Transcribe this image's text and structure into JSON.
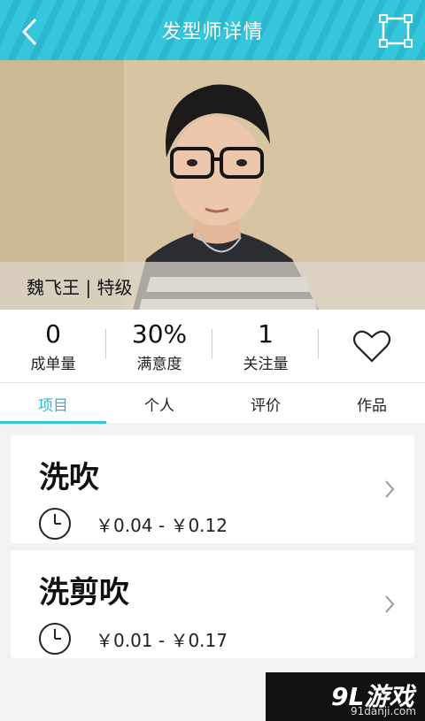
{
  "header": {
    "title": "发型师详情"
  },
  "profile": {
    "name_line": "魏飞王 | 特级"
  },
  "stats": [
    {
      "value": "0",
      "label": "成单量"
    },
    {
      "value": "30%",
      "label": "满意度"
    },
    {
      "value": "1",
      "label": "关注量"
    }
  ],
  "tabs": [
    {
      "label": "项目",
      "active": true
    },
    {
      "label": "个人",
      "active": false
    },
    {
      "label": "评价",
      "active": false
    },
    {
      "label": "作品",
      "active": false
    }
  ],
  "services": [
    {
      "name": "洗吹",
      "price": "￥0.04 - ￥0.12"
    },
    {
      "name": "洗剪吹",
      "price": "￥0.01 - ￥0.17"
    }
  ],
  "watermark": {
    "logo": "9L游戏",
    "url": "91danji.com"
  },
  "colors": {
    "accent": "#36c6dc",
    "accent_dark": "#2bb8cf"
  }
}
